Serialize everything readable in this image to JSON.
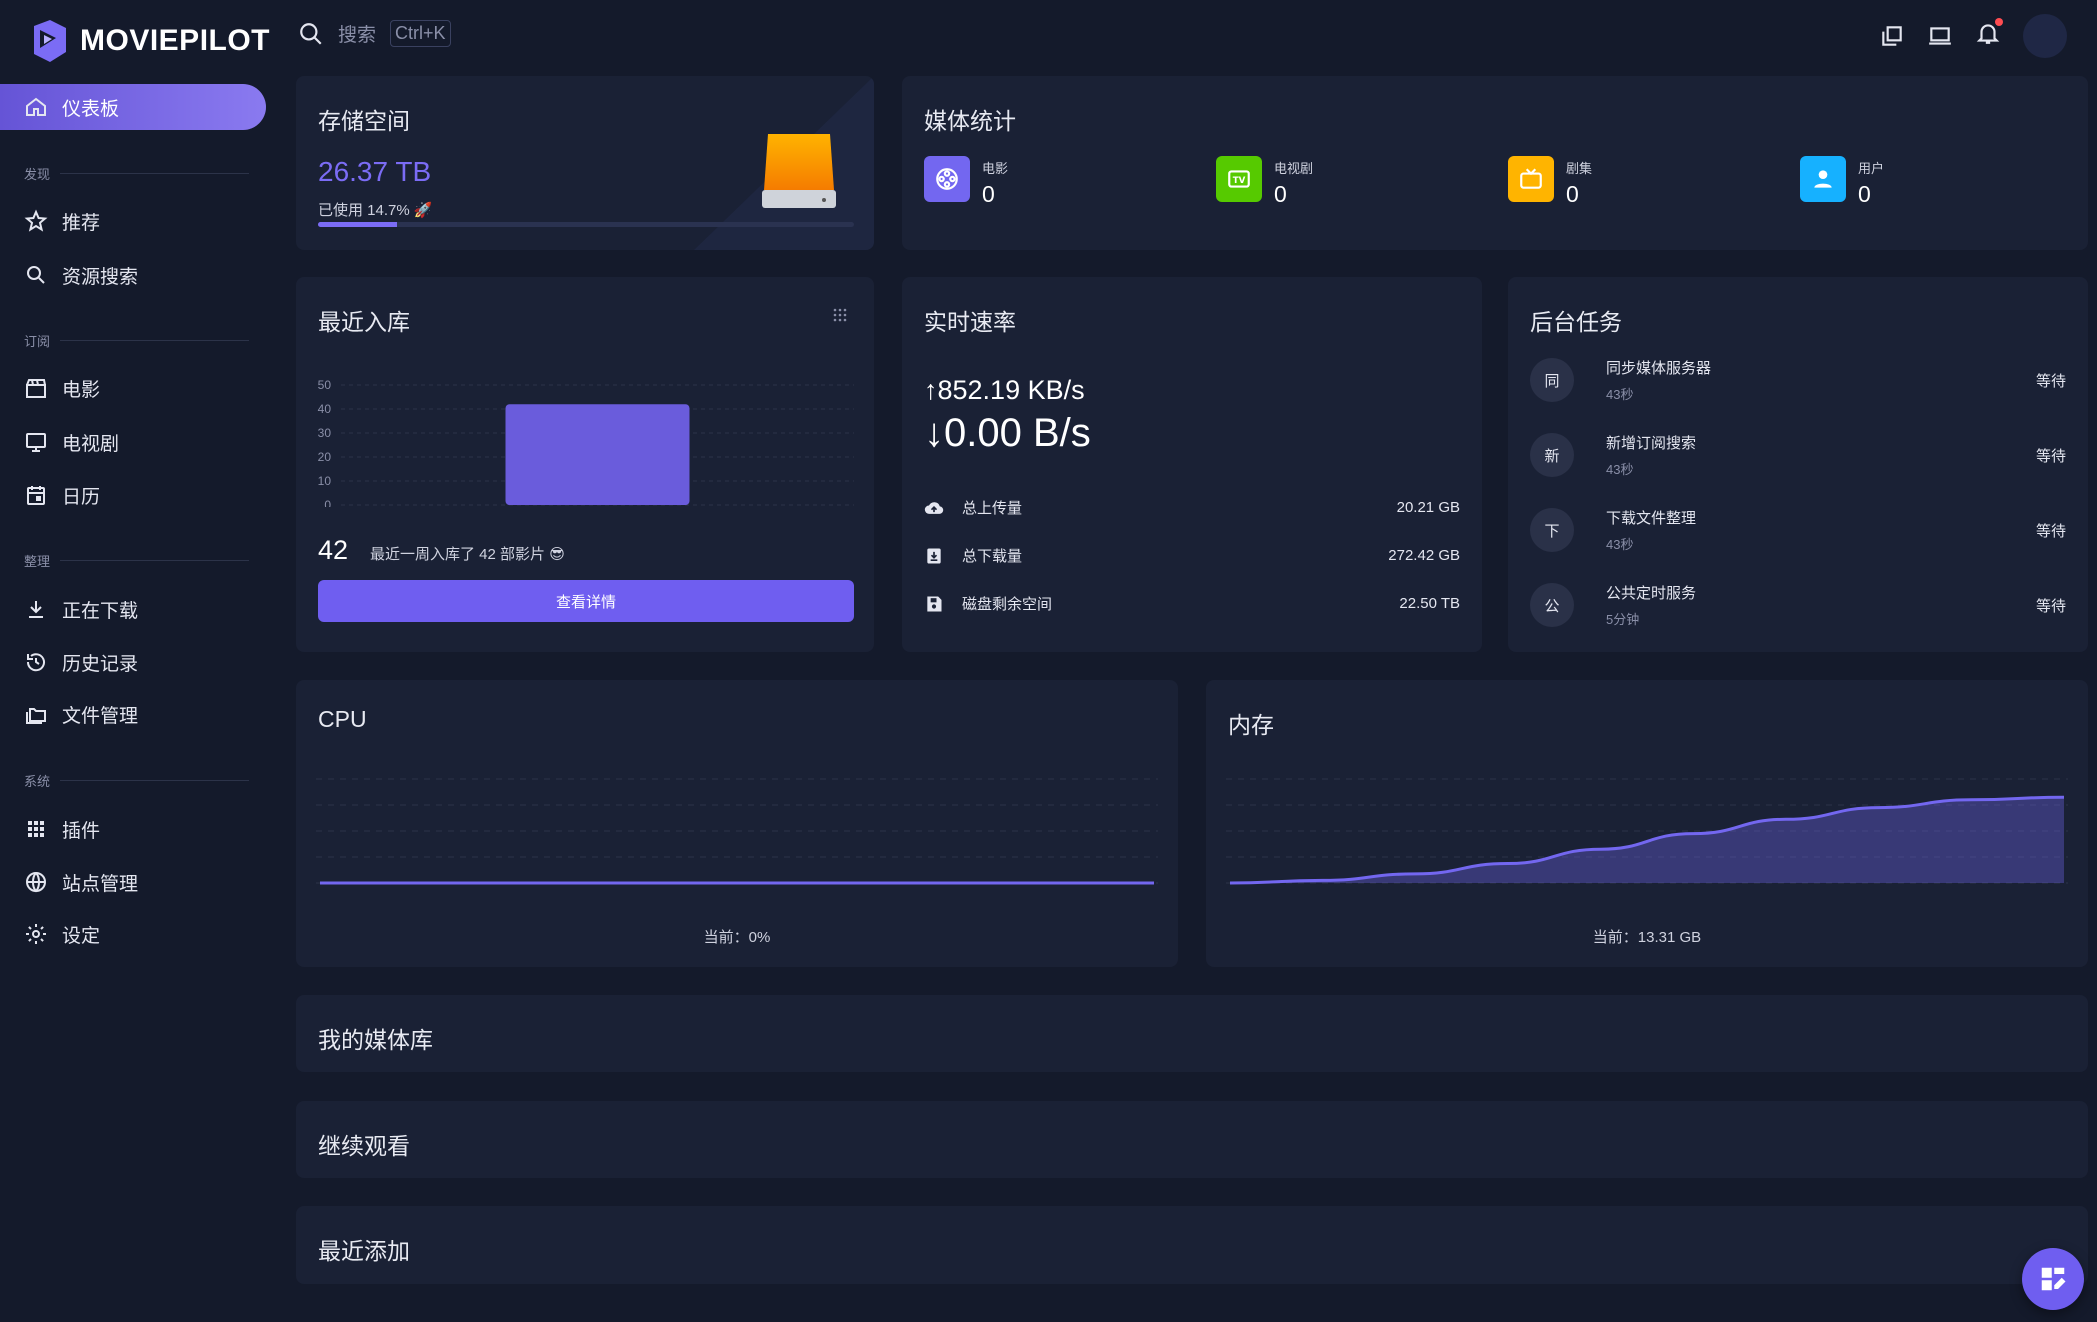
{
  "app": {
    "logo_text": "MOVIEPILOT"
  },
  "search": {
    "placeholder": "搜索",
    "shortcut": "Ctrl+K"
  },
  "sidebar": {
    "dashboard": "仪表板",
    "sections": {
      "discover": "发现",
      "subscribe": "订阅",
      "organize": "整理",
      "system": "系统"
    },
    "items": {
      "recommend": "推荐",
      "resource_search": "资源搜索",
      "movies": "电影",
      "tv": "电视剧",
      "calendar": "日历",
      "downloading": "正在下载",
      "history": "历史记录",
      "file_manager": "文件管理",
      "plugins": "插件",
      "site_manager": "站点管理",
      "settings": "设定"
    }
  },
  "storage": {
    "title": "存储空间",
    "total": "26.37 TB",
    "used_label": "已使用 14.7%",
    "used_fraction": 0.147
  },
  "media_stats": {
    "title": "媒体统计",
    "items": [
      {
        "label": "电影",
        "value": "0",
        "color": "#7367f0"
      },
      {
        "label": "电视剧",
        "value": "0",
        "color": "#56ca00"
      },
      {
        "label": "剧集",
        "value": "0",
        "color": "#ffb400"
      },
      {
        "label": "用户",
        "value": "0",
        "color": "#16b1ff"
      }
    ]
  },
  "recent_import": {
    "title": "最近入库",
    "count": "42",
    "description": "最近一周入库了 42 部影片 😎",
    "button": "查看详情"
  },
  "chart_data": [
    {
      "type": "bar",
      "categories": [
        ""
      ],
      "values": [
        42
      ],
      "yticks": [
        "50",
        "40",
        "30",
        "20",
        "10",
        "0"
      ],
      "ylim": [
        0,
        50
      ]
    },
    {
      "type": "line",
      "title": "CPU",
      "values": [
        0,
        0,
        0,
        0,
        0,
        0,
        0,
        0,
        0,
        0
      ],
      "footer": "当前：0%"
    },
    {
      "type": "area",
      "title": "内存",
      "values": [
        0.0,
        0.2,
        0.7,
        1.5,
        2.6,
        3.8,
        4.9,
        5.8,
        6.4,
        6.6
      ],
      "footer": "当前：13.31 GB"
    }
  ],
  "speed": {
    "title": "实时速率",
    "upload": "↑852.19 KB/s",
    "download": "↓0.00 B/s",
    "rows": [
      {
        "label": "总上传量",
        "value": "20.21 GB"
      },
      {
        "label": "总下载量",
        "value": "272.42 GB"
      },
      {
        "label": "磁盘剩余空间",
        "value": "22.50 TB"
      }
    ]
  },
  "tasks": {
    "title": "后台任务",
    "items": [
      {
        "badge": "同",
        "name": "同步媒体服务器",
        "time": "43秒",
        "status": "等待"
      },
      {
        "badge": "新",
        "name": "新增订阅搜索",
        "time": "43秒",
        "status": "等待"
      },
      {
        "badge": "下",
        "name": "下载文件整理",
        "time": "43秒",
        "status": "等待"
      },
      {
        "badge": "公",
        "name": "公共定时服务",
        "time": "5分钟",
        "status": "等待"
      }
    ]
  },
  "cpu": {
    "title": "CPU",
    "footer": "当前：0%"
  },
  "memory": {
    "title": "内存",
    "footer": "当前：13.31 GB"
  },
  "sections": {
    "my_library": "我的媒体库",
    "continue_watching": "继续观看",
    "recently_added": "最近添加"
  }
}
